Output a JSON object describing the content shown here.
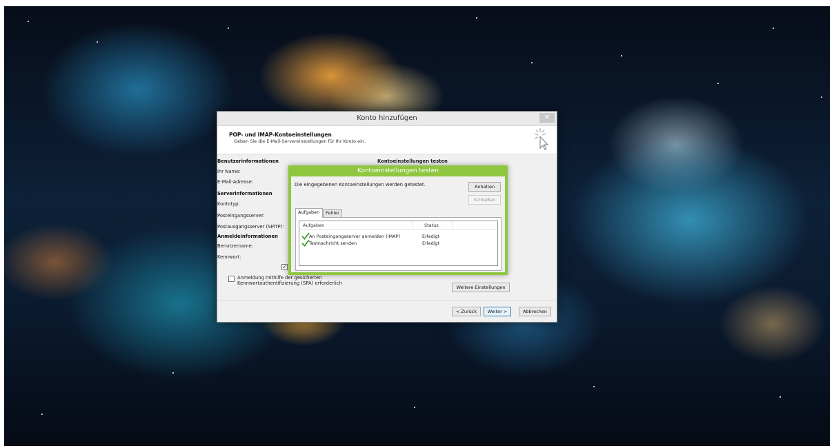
{
  "dialog": {
    "title": "Konto hinzufügen",
    "close_icon": "close-icon",
    "header_title": "POP- und IMAP-Kontoeinstellungen",
    "header_subtitle": "Geben Sie die E-Mail-Servereinstellungen für Ihr Konto ein.",
    "sections": {
      "user_info": "Benutzerinformationen",
      "server_info": "Serverinformationen",
      "login_info": "Anmeldeinformationen",
      "test_settings": "Kontoeinstellungen testen"
    },
    "labels": {
      "name": "Ihr Name:",
      "email": "E-Mail-Adresse:",
      "account_type": "Kontotyp:",
      "incoming_server": "Posteingangsserver:",
      "outgoing_server": "Postausgangsserver (SMTP):",
      "username": "Benutzername:",
      "password": "Kennwort:"
    },
    "spa_line1": "Anmeldung mithilfe der gesicherten",
    "spa_line2": "Kennwortauthentifizierung (SPA) erforderlich",
    "more_settings_button": "Weitere Einstellungen",
    "back_button": "< Zurück",
    "next_button": "Weiter >",
    "cancel_button": "Abbrechen"
  },
  "test_dialog": {
    "title": "Kontoeinstellungen testen",
    "message": "Die eingegebenen Kontoeinstellungen werden getestet.",
    "stop_button": "Anhalten",
    "close_button": "Schließen",
    "tabs": [
      "Aufgaben",
      "Fehler"
    ],
    "columns": [
      "Aufgaben",
      "Status"
    ],
    "rows": [
      {
        "task": "An Posteingangsserver anmelden (IMAP)",
        "status": "Erledigt"
      },
      {
        "task": "Testnachricht senden",
        "status": "Erledigt"
      }
    ],
    "check_icon": "checkmark-icon"
  },
  "colors": {
    "accent_green": "#8fc63f",
    "check_green": "#3a9a2a"
  }
}
